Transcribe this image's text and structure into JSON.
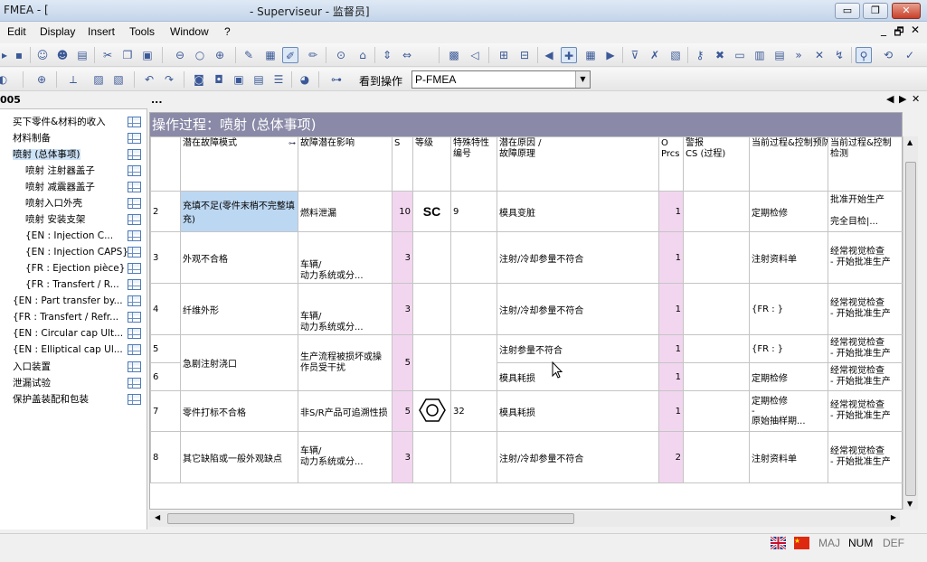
{
  "window": {
    "title_left": "FMEA - [",
    "title_right": "- Superviseur - 监督员]",
    "buttons": [
      "▭",
      "❐",
      "✕"
    ]
  },
  "menu": {
    "items": [
      "Edit",
      "Display",
      "Insert",
      "Tools",
      "Window",
      "?"
    ],
    "mdi_controls": [
      "_",
      "🗗",
      "✕"
    ]
  },
  "toolbar2": {
    "goto_label": "看到操作",
    "goto_value": "P-FMEA"
  },
  "tree": {
    "header": "005",
    "items": [
      {
        "label": "买下零件&材料的收入"
      },
      {
        "label": "材料制备"
      },
      {
        "label": "喷射 (总体事项)"
      },
      {
        "label": "喷射 注射器盖子"
      },
      {
        "label": "喷射 减震器盖子"
      },
      {
        "label": "喷射入口外壳"
      },
      {
        "label": "喷射 安装支架"
      },
      {
        "label": "{EN : Injection C..."
      },
      {
        "label": "{EN : Injection CAPS}"
      },
      {
        "label": "{FR : Ejection pièce}"
      },
      {
        "label": "{FR : Transfert / R..."
      },
      {
        "label": "{EN : Part transfer by..."
      },
      {
        "label": "{FR : Transfert / Refr..."
      },
      {
        "label": "{EN : Circular cap Ult..."
      },
      {
        "label": "{EN : Elliptical cap Ul..."
      },
      {
        "label": "入口装置"
      },
      {
        "label": "泄漏试验"
      },
      {
        "label": "保护盖装配和包装"
      }
    ]
  },
  "tabstrip": {
    "dots": "...",
    "prev": "◀",
    "next": "▶",
    "close": "✕"
  },
  "sheet": {
    "title": "操作过程：喷射 (总体事项)",
    "headers": [
      "",
      "潜在故障模式",
      "故障潜在影响",
      "S",
      "等级",
      "特殊特性\n编号",
      "潜在原因 /\n故障原理",
      "O\nPrcs",
      "警报\nCS (过程)",
      "当前过程&控制预防",
      "当前过程&控制\n检测"
    ],
    "rows": [
      {
        "no": "2",
        "mode": "充填不足(零件末梢不完整填充)",
        "effect": "燃料泄漏",
        "s": "10",
        "grade": "SC",
        "spec": "9",
        "cause": "模具变脏",
        "o": "1",
        "cs": "",
        "prev": "定期检修",
        "det": "批准开始生产\n\n完全目检|..."
      },
      {
        "no": "3",
        "mode": "外观不合格",
        "effect": "车辆/\n动力系统或分...",
        "s": "3",
        "grade": "",
        "spec": "",
        "cause": "注射/冷却参量不符合",
        "o": "1",
        "cs": "",
        "prev": "注射资料单",
        "det": "经常视觉检查\n- 开始批准生产"
      },
      {
        "no": "4",
        "mode": "纤维外形",
        "effect": "车辆/\n动力系统或分...",
        "s": "3",
        "grade": "",
        "spec": "",
        "cause": "注射/冷却参量不符合",
        "o": "1",
        "cs": "",
        "prev": "{FR : }",
        "det": "经常视觉检查\n- 开始批准生产"
      },
      {
        "no": "5",
        "mode": "急剧注射浇口",
        "effect": "生产流程被损坏或操作员受干扰",
        "s": "5",
        "grade": "",
        "spec": "",
        "cause": "注射参量不符合",
        "o": "1",
        "cs": "",
        "prev": "{FR : }",
        "det": "经常视觉检查\n- 开始批准生产"
      },
      {
        "no": "6",
        "mode": "",
        "effect": "",
        "s": "",
        "grade": "",
        "spec": "",
        "cause": "模具耗损",
        "o": "1",
        "cs": "",
        "prev": "定期检修",
        "det": "经常视觉检查\n- 开始批准生产"
      },
      {
        "no": "7",
        "mode": "零件打标不合格",
        "effect": "非S/R产品可追溯性损",
        "s": "5",
        "grade": "hexagon",
        "spec": "32",
        "cause": "模具耗损",
        "o": "1",
        "cs": "",
        "prev": "定期检修\n-\n原始抽样期...",
        "det": "经常视觉检查\n- 开始批准生产"
      },
      {
        "no": "8",
        "mode": "其它缺陷或一般外观缺点",
        "effect": "车辆/\n动力系统或分...",
        "s": "3",
        "grade": "",
        "spec": "",
        "cause": "注射/冷却参量不符合",
        "o": "2",
        "cs": "",
        "prev": "注射资料单",
        "det": "经常视觉检查\n- 开始批准生产"
      }
    ]
  },
  "status": {
    "maj": "MAJ",
    "num": "NUM",
    "def": "DEF"
  }
}
